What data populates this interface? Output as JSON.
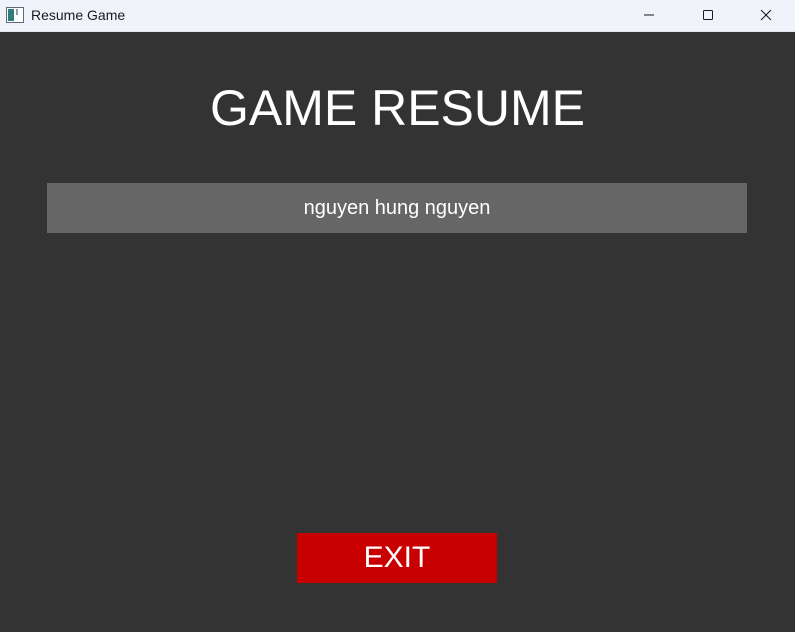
{
  "window": {
    "title": "Resume Game",
    "icon": "app-window-icon",
    "controls": [
      "minimize-icon",
      "maximize-icon",
      "close-icon"
    ]
  },
  "game": {
    "title": "GAME RESUME",
    "saves": [
      {
        "label": "nguyen hung nguyen"
      }
    ],
    "exit_label": "EXIT"
  },
  "colors": {
    "background": "#333333",
    "save_slot": "#666666",
    "exit_button": "#c80000",
    "text": "#ffffff"
  }
}
